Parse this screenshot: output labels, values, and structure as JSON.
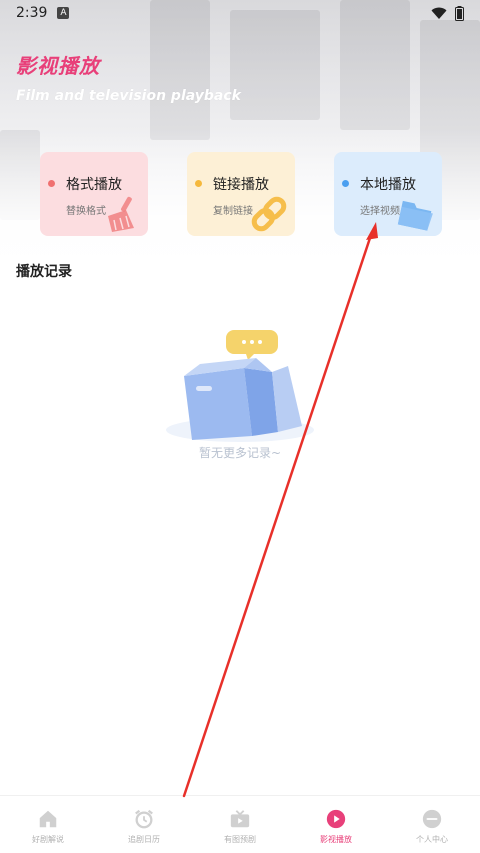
{
  "status_bar": {
    "time": "2:39",
    "notification_glyph": "A"
  },
  "header": {
    "title": "影视播放",
    "subtitle": "Film and television playback"
  },
  "cards": [
    {
      "title": "格式播放",
      "subtitle": "替换格式",
      "icon": "broom-icon",
      "bg": "#fcdde0",
      "accent": "#f07070"
    },
    {
      "title": "链接播放",
      "subtitle": "复制链接",
      "icon": "chain-link-icon",
      "bg": "#fdf0d6",
      "accent": "#f5b83c"
    },
    {
      "title": "本地播放",
      "subtitle": "选择视频",
      "icon": "folder-icon",
      "bg": "#dcecfc",
      "accent": "#4a9ff0"
    }
  ],
  "records": {
    "title": "播放记录",
    "empty_text": "暂无更多记录~"
  },
  "bottom_nav": {
    "items": [
      {
        "label": "好剧解说",
        "icon": "home-icon",
        "active": false
      },
      {
        "label": "追剧日历",
        "icon": "alarm-clock-icon",
        "active": false
      },
      {
        "label": "有图预剧",
        "icon": "tv-icon",
        "active": false
      },
      {
        "label": "影视播放",
        "icon": "play-circle-icon",
        "active": true
      },
      {
        "label": "个人中心",
        "icon": "profile-icon",
        "active": false
      }
    ]
  },
  "colors": {
    "accent_pink": "#e8407a",
    "annotation_arrow": "#e8302a"
  }
}
